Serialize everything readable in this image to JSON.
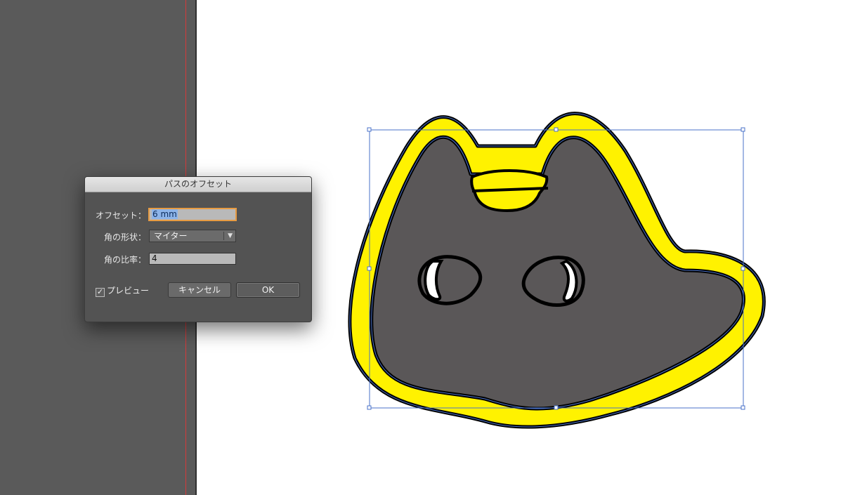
{
  "dialog": {
    "title": "パスのオフセット",
    "offset": {
      "label": "オフセット：",
      "value": "6 mm"
    },
    "corner": {
      "label": "角の形状：",
      "value": "マイター"
    },
    "miter_limit": {
      "label": "角の比率：",
      "value": "4"
    },
    "preview": {
      "label": "プレビュー",
      "checked": true,
      "check_glyph": "✓"
    },
    "cancel_label": "キャンセル",
    "ok_label": "OK"
  },
  "colors": {
    "pasteboard": "#5a5a5a",
    "bleed_line": "#d63a3a",
    "offset_fill": "#fff200",
    "original_fill": "#5a5758",
    "stroke": "#000000",
    "selection": "#4a72c8"
  }
}
